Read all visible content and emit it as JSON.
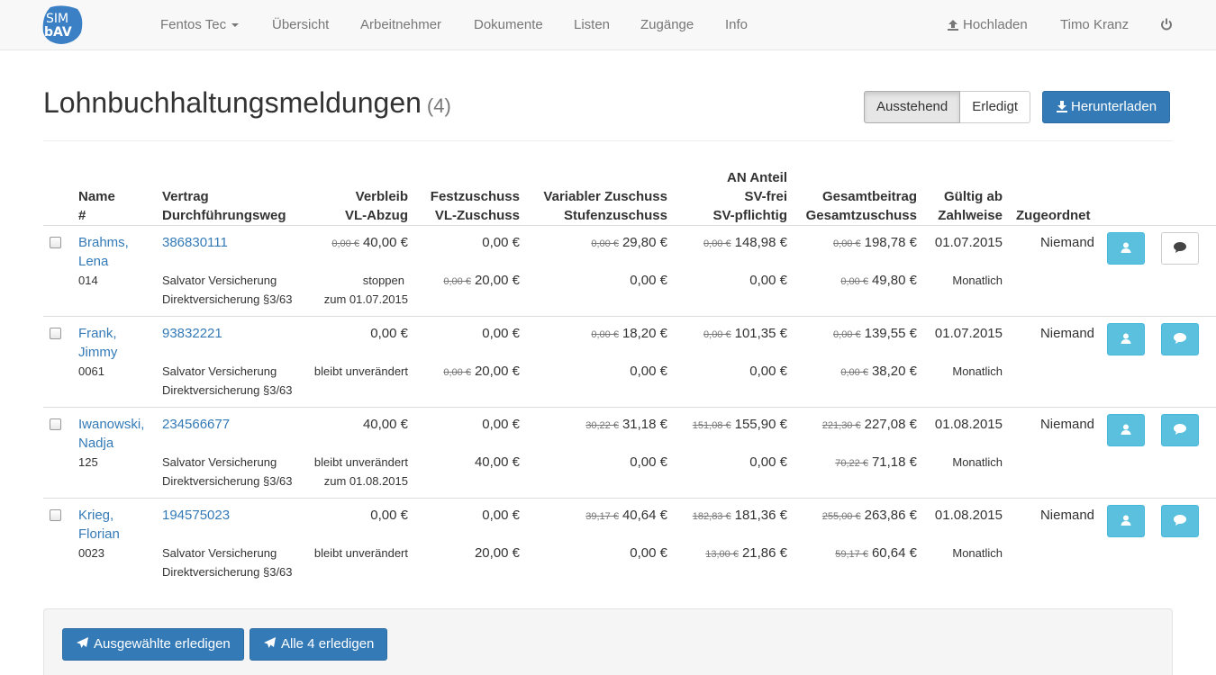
{
  "brand": {
    "line1": "SIM",
    "line2": "bAV"
  },
  "nav": {
    "company": "Fentos Tec",
    "items": [
      "Übersicht",
      "Arbeitnehmer",
      "Dokumente",
      "Listen",
      "Zugänge",
      "Info"
    ],
    "upload": "Hochladen",
    "user": "Timo Kranz"
  },
  "header": {
    "title": "Lohnbuchhaltungsmeldungen",
    "count": "(4)",
    "filter_pending": "Ausstehend",
    "filter_done": "Erledigt",
    "download": "Herunterladen"
  },
  "columns": {
    "name": [
      "Name",
      "#"
    ],
    "vertrag": [
      "Vertrag",
      "Durchführungsweg"
    ],
    "verbleib": [
      "Verbleib",
      "VL-Abzug"
    ],
    "fest": [
      "Festzuschuss",
      "VL-Zuschuss"
    ],
    "variabel": [
      "Variabler Zuschuss",
      "Stufenzuschuss"
    ],
    "an": [
      "AN Anteil",
      "SV-frei",
      "SV-pflichtig"
    ],
    "gesamt": [
      "Gesamtbeitrag",
      "Gesamtzuschuss"
    ],
    "gueltig": [
      "Gültig ab",
      "Zahlweise"
    ],
    "zugeordnet": "Zugeordnet"
  },
  "rows": [
    {
      "name1": "Brahms,",
      "name2": "Lena",
      "number": "014",
      "contract": "386830111",
      "provider": "Salvator Versicherung",
      "way": "Direktversicherung §3/63",
      "verbleib_old": "0,00 €",
      "verbleib": "40,00 €",
      "vl_status": "stoppen",
      "vl_date": "zum 01.07.2015",
      "fest_old": "",
      "fest": "0,00 €",
      "vlz_old": "0,00 €",
      "vlz": "20,00 €",
      "var_old": "0,00 €",
      "var": "29,80 €",
      "stufe_old": "",
      "stufe": "0,00 €",
      "an_old": "0,00 €",
      "an": "148,98 €",
      "sv_old": "",
      "sv": "0,00 €",
      "ges_old": "0,00 €",
      "ges": "198,78 €",
      "gz_old": "0,00 €",
      "gz": "49,80 €",
      "valid": "01.07.2015",
      "payment": "Monatlich",
      "assigned": "Niemand",
      "comment_style": "default"
    },
    {
      "name1": "Frank,",
      "name2": "Jimmy",
      "number": "0061",
      "contract": "93832221",
      "provider": "Salvator Versicherung",
      "way": "Direktversicherung §3/63",
      "verbleib_old": "",
      "verbleib": "0,00 €",
      "vl_status": "bleibt unverändert",
      "vl_date": "",
      "fest_old": "",
      "fest": "0,00 €",
      "vlz_old": "0,00 €",
      "vlz": "20,00 €",
      "var_old": "0,00 €",
      "var": "18,20 €",
      "stufe_old": "",
      "stufe": "0,00 €",
      "an_old": "0,00 €",
      "an": "101,35 €",
      "sv_old": "",
      "sv": "0,00 €",
      "ges_old": "0,00 €",
      "ges": "139,55 €",
      "gz_old": "0,00 €",
      "gz": "38,20 €",
      "valid": "01.07.2015",
      "payment": "Monatlich",
      "assigned": "Niemand",
      "comment_style": "info"
    },
    {
      "name1": "Iwanowski,",
      "name2": "Nadja",
      "number": "125",
      "contract": "234566677",
      "provider": "Salvator Versicherung",
      "way": "Direktversicherung §3/63",
      "verbleib_old": "",
      "verbleib": "40,00 €",
      "vl_status": "bleibt unverändert",
      "vl_date": "zum 01.08.2015",
      "fest_old": "",
      "fest": "0,00 €",
      "vlz_old": "",
      "vlz": "40,00 €",
      "var_old": "30,22 €",
      "var": "31,18 €",
      "stufe_old": "",
      "stufe": "0,00 €",
      "an_old": "151,08 €",
      "an": "155,90 €",
      "sv_old": "",
      "sv": "0,00 €",
      "ges_old": "221,30 €",
      "ges": "227,08 €",
      "gz_old": "70,22 €",
      "gz": "71,18 €",
      "valid": "01.08.2015",
      "payment": "Monatlich",
      "assigned": "Niemand",
      "comment_style": "info"
    },
    {
      "name1": "Krieg,",
      "name2": "Florian",
      "number": "0023",
      "contract": "194575023",
      "provider": "Salvator Versicherung",
      "way": "Direktversicherung §3/63",
      "verbleib_old": "",
      "verbleib": "0,00 €",
      "vl_status": "bleibt unverändert",
      "vl_date": "",
      "fest_old": "",
      "fest": "0,00 €",
      "vlz_old": "",
      "vlz": "20,00 €",
      "var_old": "39,17 €",
      "var": "40,64 €",
      "stufe_old": "",
      "stufe": "0,00 €",
      "an_old": "182,83 €",
      "an": "181,36 €",
      "sv_old": "13,00 €",
      "sv": "21,86 €",
      "ges_old": "255,00 €",
      "ges": "263,86 €",
      "gz_old": "59,17 €",
      "gz": "60,64 €",
      "valid": "01.08.2015",
      "payment": "Monatlich",
      "assigned": "Niemand",
      "comment_style": "info"
    }
  ],
  "footer": {
    "complete_selected": "Ausgewählte erledigen",
    "complete_all": "Alle 4 erledigen"
  },
  "colors": {
    "primary": "#337ab7",
    "info": "#5bc0de",
    "brand": "#3b7fc4"
  },
  "icons": [
    "upload-icon",
    "power-icon",
    "download-icon",
    "user-icon",
    "comment-icon",
    "send-icon"
  ]
}
